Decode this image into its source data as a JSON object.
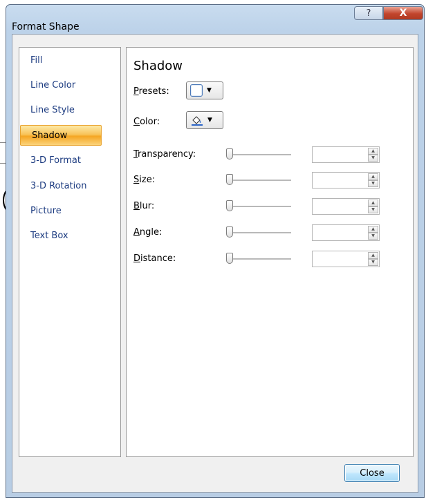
{
  "window": {
    "title": "Format Shape",
    "help_glyph": "?",
    "close_glyph": "X"
  },
  "nav": {
    "items": [
      {
        "label": "Fill",
        "selected": false
      },
      {
        "label": "Line Color",
        "selected": false
      },
      {
        "label": "Line Style",
        "selected": false
      },
      {
        "label": "Shadow",
        "selected": true
      },
      {
        "label": "3-D Format",
        "selected": false
      },
      {
        "label": "3-D Rotation",
        "selected": false
      },
      {
        "label": "Picture",
        "selected": false
      },
      {
        "label": "Text Box",
        "selected": false
      }
    ]
  },
  "panel": {
    "title": "Shadow",
    "presets": {
      "label_first": "P",
      "label_rest": "resets:",
      "icon": "shadow-preset-icon"
    },
    "color": {
      "label_first": "C",
      "label_rest": "olor:",
      "icon": "paint-bucket-icon"
    },
    "dropdown_arrow": "▼",
    "sliders": [
      {
        "key": "transparency",
        "label_first": "T",
        "label_rest": "ransparency:",
        "value": ""
      },
      {
        "key": "size",
        "label_first": "S",
        "label_rest": "ize:",
        "value": ""
      },
      {
        "key": "blur",
        "label_first": "B",
        "label_rest": "lur:",
        "value": ""
      },
      {
        "key": "angle",
        "label_first": "A",
        "label_rest": "ngle:",
        "value": ""
      },
      {
        "key": "distance",
        "label_first": "D",
        "label_rest": "istance:",
        "value": ""
      }
    ],
    "spin_up": "▲",
    "spin_down": "▼"
  },
  "footer": {
    "close_label": "Close"
  },
  "colors": {
    "nav_text": "#1c3b80",
    "selected_bg": "#f8c45a",
    "window_frame": "#bcd2e9",
    "close_red": "#c2452d"
  }
}
